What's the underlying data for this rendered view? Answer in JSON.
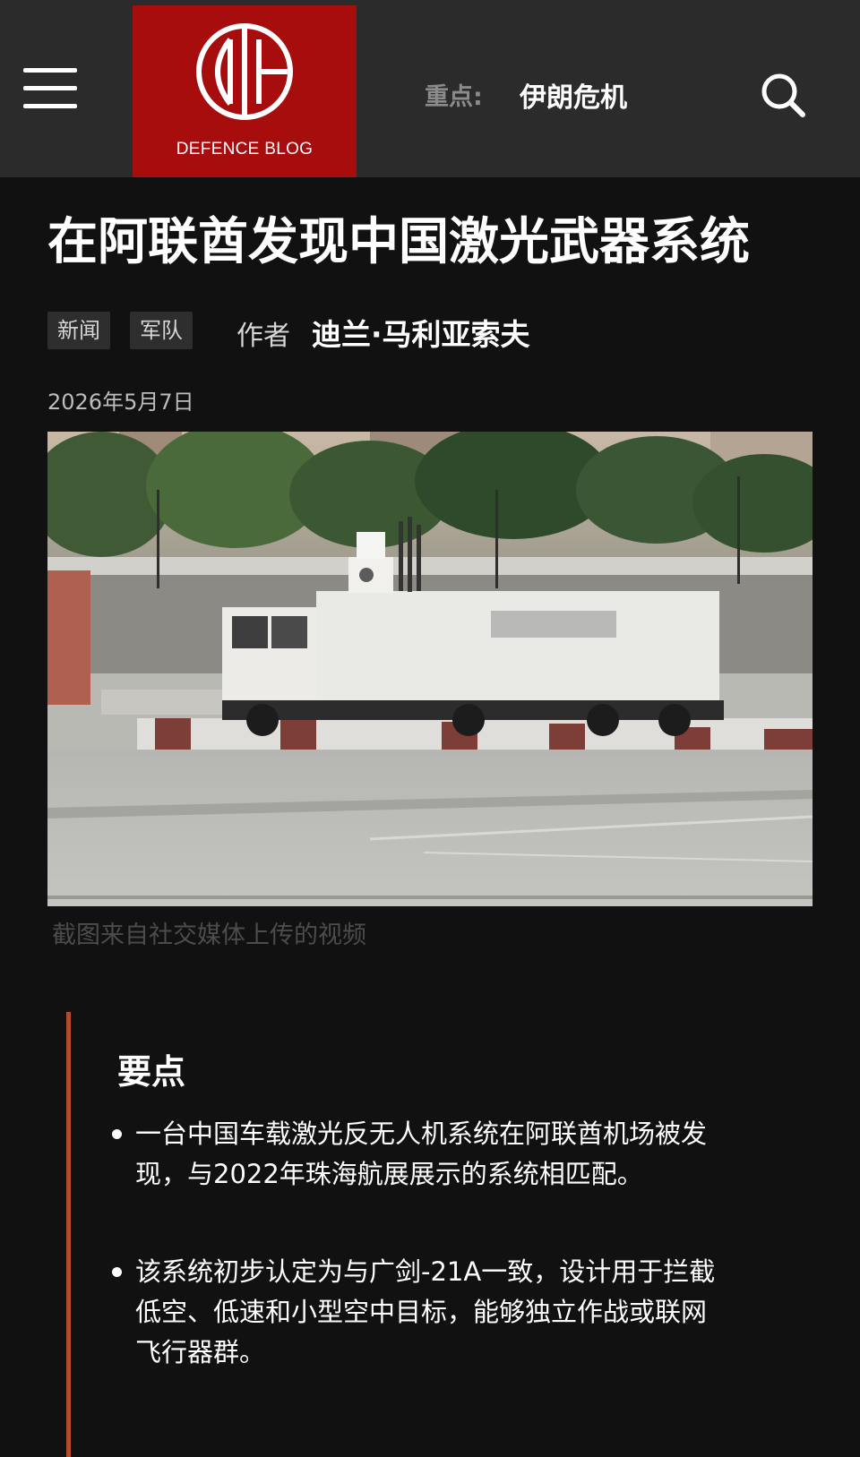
{
  "header": {
    "logo_text": "DEFENCE BLOG",
    "logo_monogram": "DB",
    "focus_label": "重点:",
    "focus_link": "伊朗危机",
    "menu_icon": "hamburger-menu-icon",
    "search_icon": "search-icon"
  },
  "article": {
    "title": "在阿联酋发现中国激光武器系统",
    "tags": [
      "新闻",
      "军队"
    ],
    "author_label": "作者",
    "author_name": "迪兰·马利亚索夫",
    "date": "2026年5月7日",
    "photo_caption": "截图来自社交媒体上传的视频"
  },
  "key_points": {
    "title": "要点",
    "items": [
      "一台中国车载激光反无人机系统在阿联酋机场被发现，与2022年珠海航展展示的系统相匹配。",
      "该系统初步认定为与广剑-21A一致，设计用于拦截低空、低速和小型空中目标，能够独立作战或联网飞行器群。"
    ]
  },
  "colors": {
    "header_bg": "#2b2b2b",
    "page_bg": "#111111",
    "logo_red": "#a80d0d",
    "accent_border": "#b5482d"
  }
}
